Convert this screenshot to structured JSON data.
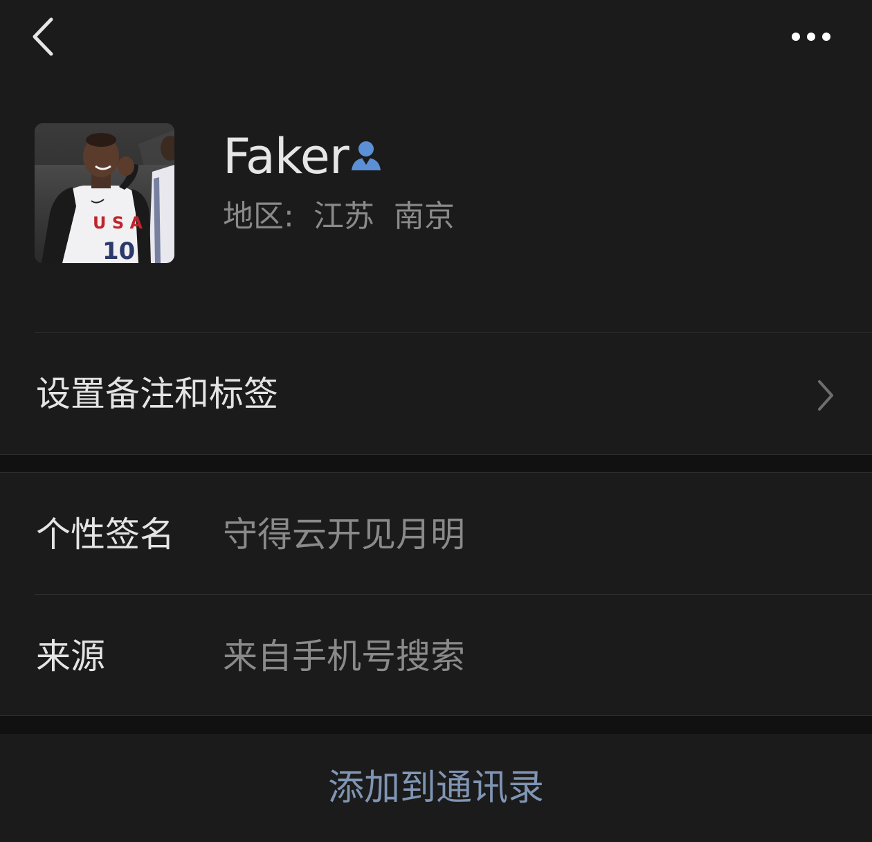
{
  "nav": {
    "back_icon": "chevron-left-icon",
    "more_icon": "more-horizontal-icon"
  },
  "profile": {
    "name": "Faker",
    "gender_icon": "male-user-icon",
    "gender_color": "#5b8fd6",
    "region_label": "地区:",
    "region_province": "江苏",
    "region_city": "南京",
    "avatar_description_icon": "avatar-photo"
  },
  "menu": {
    "remark_label": "设置备注和标签"
  },
  "info": {
    "rows": [
      {
        "key": "个性签名",
        "value": "守得云开见月明"
      },
      {
        "key": "来源",
        "value": "来自手机号搜索"
      }
    ]
  },
  "action": {
    "add_contact_label": "添加到通讯录",
    "color": "#8095b4"
  },
  "theme": {
    "background": "#111111",
    "card": "#1b1b1b",
    "primary_text": "#e4e4e4",
    "secondary_text": "#8a8a8a"
  }
}
